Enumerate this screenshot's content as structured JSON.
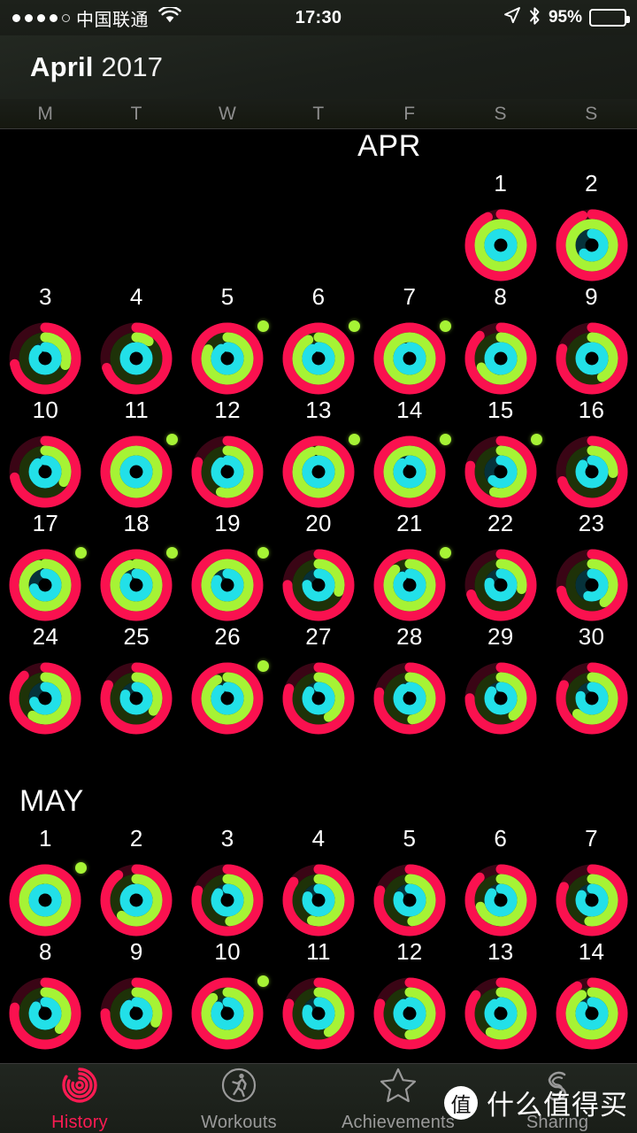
{
  "status_bar": {
    "signal_dots_filled": 4,
    "signal_dots_total": 5,
    "carrier": "中国联通",
    "wifi_icon": "wifi-icon",
    "time": "17:30",
    "location_icon": "location-arrow-icon",
    "bluetooth_icon": "bluetooth-icon",
    "battery_percent": "95%",
    "battery_level": 95
  },
  "navbar": {
    "month": "April",
    "year": "2017"
  },
  "weekdays": [
    "M",
    "T",
    "W",
    "T",
    "F",
    "S",
    "S"
  ],
  "colors": {
    "move_ring": "#FA114F",
    "exercise_ring": "#A6F335",
    "stand_ring": "#22E0E8",
    "move_track": "#3a0515",
    "exercise_track": "#1e3208",
    "stand_track": "#06323a",
    "accent_active": "#FB1B53",
    "tab_inactive": "#9A9A9A",
    "background": "#000000"
  },
  "months": [
    {
      "label": "APR",
      "lead_blanks": 5,
      "days": [
        {
          "day": "1",
          "move": 0.93,
          "exercise": 1.0,
          "stand": 1.0,
          "goal_dot": false
        },
        {
          "day": "2",
          "move": 0.95,
          "exercise": 1.0,
          "stand": 0.62,
          "goal_dot": false
        },
        {
          "day": "3",
          "move": 0.72,
          "exercise": 0.3,
          "stand": 0.88,
          "goal_dot": false
        },
        {
          "day": "4",
          "move": 0.7,
          "exercise": 0.1,
          "stand": 0.95,
          "goal_dot": false
        },
        {
          "day": "5",
          "move": 1.0,
          "exercise": 0.82,
          "stand": 0.9,
          "goal_dot": true
        },
        {
          "day": "6",
          "move": 1.0,
          "exercise": 0.92,
          "stand": 0.9,
          "goal_dot": true
        },
        {
          "day": "7",
          "move": 1.0,
          "exercise": 1.0,
          "stand": 0.92,
          "goal_dot": true
        },
        {
          "day": "8",
          "move": 0.88,
          "exercise": 0.68,
          "stand": 1.0,
          "goal_dot": false
        },
        {
          "day": "9",
          "move": 0.8,
          "exercise": 0.42,
          "stand": 0.95,
          "goal_dot": false
        },
        {
          "day": "10",
          "move": 0.72,
          "exercise": 0.33,
          "stand": 0.88,
          "goal_dot": false
        },
        {
          "day": "11",
          "move": 1.0,
          "exercise": 1.0,
          "stand": 1.0,
          "goal_dot": true
        },
        {
          "day": "12",
          "move": 0.8,
          "exercise": 0.55,
          "stand": 0.9,
          "goal_dot": false
        },
        {
          "day": "13",
          "move": 1.0,
          "exercise": 0.95,
          "stand": 0.95,
          "goal_dot": true
        },
        {
          "day": "14",
          "move": 1.0,
          "exercise": 1.0,
          "stand": 0.88,
          "goal_dot": true
        },
        {
          "day": "15",
          "move": 0.78,
          "exercise": 0.55,
          "stand": 0.62,
          "goal_dot": true
        },
        {
          "day": "16",
          "move": 0.7,
          "exercise": 0.26,
          "stand": 0.85,
          "goal_dot": false
        },
        {
          "day": "17",
          "move": 1.0,
          "exercise": 0.95,
          "stand": 0.7,
          "goal_dot": true
        },
        {
          "day": "18",
          "move": 1.0,
          "exercise": 0.95,
          "stand": 0.85,
          "goal_dot": true
        },
        {
          "day": "19",
          "move": 1.0,
          "exercise": 1.0,
          "stand": 0.82,
          "goal_dot": true
        },
        {
          "day": "20",
          "move": 0.75,
          "exercise": 0.3,
          "stand": 0.75,
          "goal_dot": false
        },
        {
          "day": "21",
          "move": 1.0,
          "exercise": 0.88,
          "stand": 0.88,
          "goal_dot": true
        },
        {
          "day": "22",
          "move": 0.7,
          "exercise": 0.28,
          "stand": 0.78,
          "goal_dot": false
        },
        {
          "day": "23",
          "move": 0.72,
          "exercise": 0.4,
          "stand": 0.55,
          "goal_dot": false
        },
        {
          "day": "24",
          "move": 0.88,
          "exercise": 0.6,
          "stand": 0.7,
          "goal_dot": false
        },
        {
          "day": "25",
          "move": 0.82,
          "exercise": 0.35,
          "stand": 0.8,
          "goal_dot": false
        },
        {
          "day": "26",
          "move": 1.0,
          "exercise": 0.92,
          "stand": 0.88,
          "goal_dot": true
        },
        {
          "day": "27",
          "move": 0.8,
          "exercise": 0.42,
          "stand": 0.85,
          "goal_dot": false
        },
        {
          "day": "28",
          "move": 0.78,
          "exercise": 0.48,
          "stand": 0.9,
          "goal_dot": false
        },
        {
          "day": "29",
          "move": 0.75,
          "exercise": 0.4,
          "stand": 0.85,
          "goal_dot": false
        },
        {
          "day": "30",
          "move": 0.82,
          "exercise": 0.62,
          "stand": 0.78,
          "goal_dot": false
        }
      ]
    },
    {
      "label": "MAY",
      "lead_blanks": 0,
      "days": [
        {
          "day": "1",
          "move": 1.0,
          "exercise": 1.0,
          "stand": 0.95,
          "goal_dot": true
        },
        {
          "day": "2",
          "move": 0.9,
          "exercise": 0.62,
          "stand": 0.95,
          "goal_dot": false
        },
        {
          "day": "3",
          "move": 0.8,
          "exercise": 0.48,
          "stand": 0.85,
          "goal_dot": false
        },
        {
          "day": "4",
          "move": 0.85,
          "exercise": 0.55,
          "stand": 0.8,
          "goal_dot": false
        },
        {
          "day": "5",
          "move": 0.8,
          "exercise": 0.48,
          "stand": 0.8,
          "goal_dot": false
        },
        {
          "day": "6",
          "move": 0.88,
          "exercise": 0.7,
          "stand": 0.85,
          "goal_dot": false
        },
        {
          "day": "7",
          "move": 0.82,
          "exercise": 0.52,
          "stand": 0.82,
          "goal_dot": false
        },
        {
          "day": "8",
          "move": 0.78,
          "exercise": 0.38,
          "stand": 0.85,
          "goal_dot": false
        },
        {
          "day": "9",
          "move": 0.75,
          "exercise": 0.32,
          "stand": 0.88,
          "goal_dot": false
        },
        {
          "day": "10",
          "move": 1.0,
          "exercise": 0.88,
          "stand": 0.85,
          "goal_dot": true
        },
        {
          "day": "11",
          "move": 0.8,
          "exercise": 0.42,
          "stand": 0.8,
          "goal_dot": false
        },
        {
          "day": "12",
          "move": 0.8,
          "exercise": 0.5,
          "stand": 0.9,
          "goal_dot": false
        },
        {
          "day": "13",
          "move": 0.85,
          "exercise": 0.58,
          "stand": 0.9,
          "goal_dot": false
        },
        {
          "day": "14",
          "move": 0.92,
          "exercise": 0.92,
          "stand": 0.85,
          "goal_dot": false
        }
      ]
    }
  ],
  "tabs": [
    {
      "label": "History",
      "icon": "activity-rings-icon",
      "active": true
    },
    {
      "label": "Workouts",
      "icon": "running-person-icon",
      "active": false
    },
    {
      "label": "Achievements",
      "icon": "star-icon",
      "active": false
    },
    {
      "label": "Sharing",
      "icon": "sharing-icon",
      "active": false
    }
  ],
  "watermark": {
    "badge": "值",
    "text": "什么值得买"
  }
}
